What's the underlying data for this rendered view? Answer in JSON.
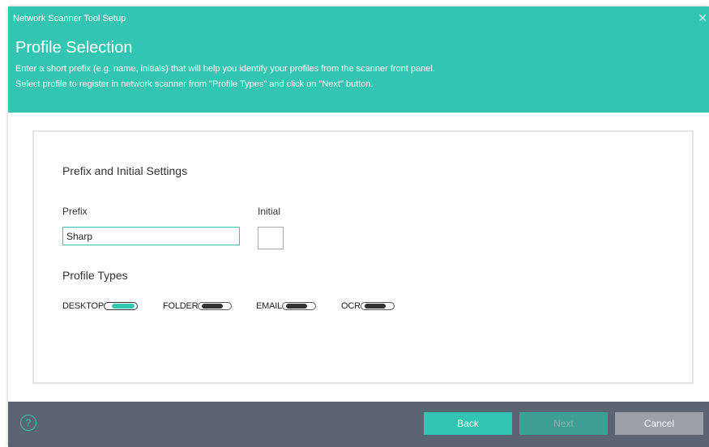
{
  "window": {
    "title": "Network Scanner Tool Setup",
    "close_glyph": "✕"
  },
  "header": {
    "title": "Profile Selection",
    "description_1": "Enter a short prefix (e.g. name, initials) that will help you identify your profiles from the scanner front panel.",
    "description_2": "Select profile to register in network scanner from \"Profile Types\" and click on \"Next\" button."
  },
  "settings": {
    "section_title": "Prefix and Initial Settings",
    "prefix_label": "Prefix",
    "prefix_value": "Sharp",
    "initial_label": "Initial"
  },
  "profile_types": {
    "section_title": "Profile Types",
    "items": [
      {
        "label": "DESKTOP",
        "on": true
      },
      {
        "label": "FOLDER",
        "on": false
      },
      {
        "label": "EMAIL",
        "on": false
      },
      {
        "label": "OCR",
        "on": false
      }
    ]
  },
  "footer": {
    "help_glyph": "?",
    "back_label": "Back",
    "next_label": "Next",
    "cancel_label": "Cancel"
  },
  "colors": {
    "accent": "#33c5b2",
    "footer": "#5a6473"
  }
}
